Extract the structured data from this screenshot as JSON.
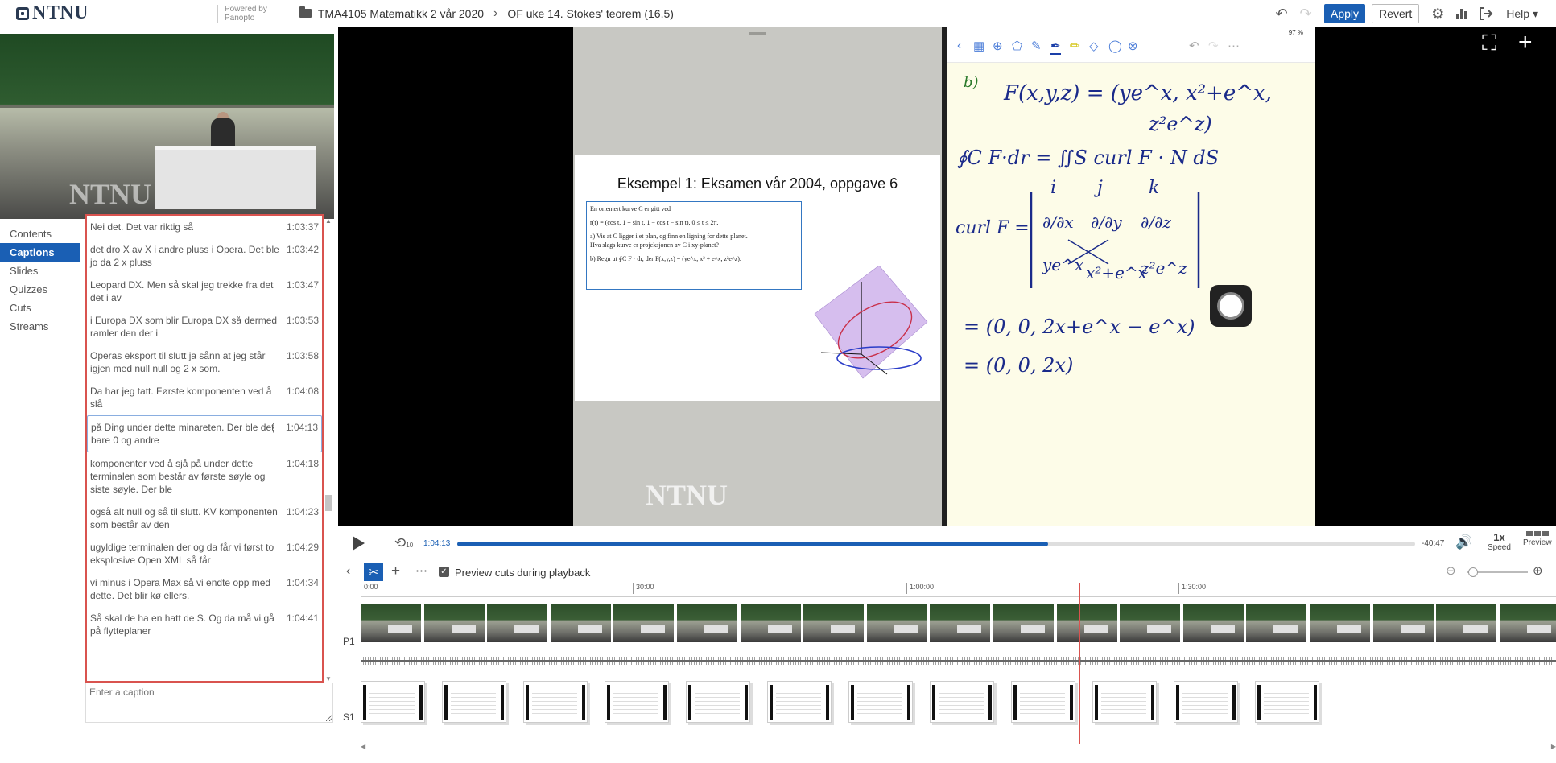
{
  "topbar": {
    "logo": "NTNU",
    "powered_by": "Powered by",
    "powered_by_brand": "Panopto",
    "folder": "TMA4105 Matematikk 2 vår 2020",
    "session": "OF uke 14. Stokes' teorem (16.5)",
    "apply_label": "Apply",
    "revert_label": "Revert",
    "help_label": "Help"
  },
  "presenter": {
    "watermark": "NTNU"
  },
  "sidenav": {
    "items": [
      {
        "label": "Contents"
      },
      {
        "label": "Captions",
        "active": true
      },
      {
        "label": "Slides"
      },
      {
        "label": "Quizzes"
      },
      {
        "label": "Cuts"
      },
      {
        "label": "Streams"
      }
    ]
  },
  "captions": {
    "items": [
      {
        "text": "Nei det. Det var riktig så",
        "time": "1:03:37"
      },
      {
        "text": "det dro X av X i andre pluss i Opera. Det ble jo da 2 x pluss",
        "time": "1:03:42"
      },
      {
        "text": "Leopard DX. Men så skal jeg trekke fra det det i av",
        "time": "1:03:47"
      },
      {
        "text": "i Europa DX som blir Europa DX så dermed ramler den der i",
        "time": "1:03:53"
      },
      {
        "text": "Operas eksport til slutt ja sånn at jeg står igjen med null null og 2 x som.",
        "time": "1:03:58"
      },
      {
        "text": "Da har jeg tatt. Første komponenten ved å slå",
        "time": "1:04:08"
      },
      {
        "text": "på Ding under dette minareten. Der ble det bare 0 og andre",
        "time": "1:04:13",
        "selected": true
      },
      {
        "text": "komponenter ved å sjå på under dette terminalen som består av første søyle og siste søyle. Der ble",
        "time": "1:04:18"
      },
      {
        "text": "også alt null og så til slutt. KV komponenten som består av den",
        "time": "1:04:23"
      },
      {
        "text": "ugyldige terminalen der og da får vi først to eksplosive Open XML så får",
        "time": "1:04:29"
      },
      {
        "text": "vi minus i Opera Max så vi endte opp med dette. Det blir kø ellers.",
        "time": "1:04:34"
      },
      {
        "text": "Så skal de ha en hatt de S. Og da må vi gå på flytteplaner",
        "time": "1:04:41"
      }
    ],
    "input_placeholder": "Enter a caption"
  },
  "slide": {
    "title": "Eksempel 1: Eksamen vår 2004, oppgave 6",
    "line1": "En orientert kurve C er gitt ved",
    "line2": "r(t) = (cos t, 1 + sin t, 1 − cos t − sin t),        0 ≤ t ≤ 2π.",
    "line3": "a)   Vis at C ligger i et plan, og finn en ligning for dette planet.",
    "line4": "       Hva slags kurve er projeksjonen av C i xy-planet?",
    "line5": "b)   Regn ut ∮C F · dr, der F(x,y,z) = (ye^x, x² + e^x, z²e^z).",
    "watermark": "NTNU"
  },
  "notes": {
    "status": "97 %",
    "part": "b)",
    "line1": "F(x,y,z) = (ye^x, x²+e^x,",
    "line1b": "z²e^z)",
    "line2": "∮C F·dr  =  ∬S curl F · N dS",
    "ijk": [
      "i",
      "j",
      "k"
    ],
    "curl_label": "curl F =",
    "partials": [
      "∂/∂x",
      "∂/∂y",
      "∂/∂z"
    ],
    "row3": [
      "ye^x",
      "x²+e^x",
      "z²e^z"
    ],
    "line3": "= (0, 0, 2x+e^x − e^x)",
    "line4": "= (0, 0, 2x)"
  },
  "controls": {
    "current_time": "1:04:13",
    "remaining_time": "-40:47",
    "progress": 0.617,
    "speed_value": "1x",
    "speed_label": "Speed",
    "preview_label": "Preview",
    "rewind_label": "10"
  },
  "edit_toolbar": {
    "preview_cuts_label": "Preview cuts during playback",
    "preview_cuts_checked": true
  },
  "timeline": {
    "ticks": [
      "0:00",
      "30:00",
      "1:00:00",
      "1:30:00"
    ],
    "lane_labels": [
      "P1",
      "S1"
    ]
  },
  "colors": {
    "accent": "#1a5fb4",
    "caption_border": "#d9534f",
    "playhead": "#d9534f"
  }
}
